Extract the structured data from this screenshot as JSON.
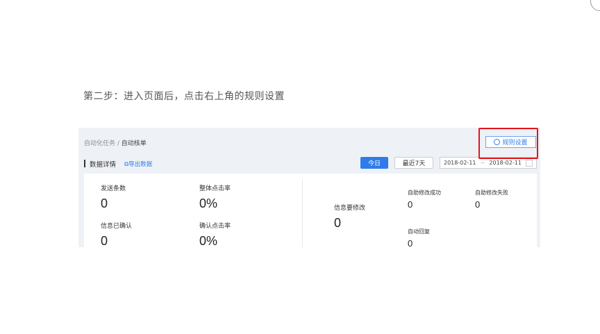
{
  "instruction": "第二步：进入页面后，点击右上角的规则设置",
  "breadcrumb": {
    "parent": "自动化任务 / ",
    "current": "自动核单"
  },
  "toolbar": {
    "rules_button": "规则设置"
  },
  "section": {
    "title": "数据详情",
    "export_link": "⧉导出数据",
    "today_button": "今日",
    "last7_button": "最近7天",
    "date_from": "2018-02-11",
    "date_sep": "~",
    "date_to": "2018-02-11"
  },
  "metrics": {
    "sent_count": {
      "label": "发送条数",
      "value": "0"
    },
    "overall_ctr": {
      "label": "整体点击率",
      "value": "0%"
    },
    "info_confirmed": {
      "label": "信息已确认",
      "value": "0"
    },
    "confirm_ctr": {
      "label": "确认点击率",
      "value": "0%"
    },
    "info_to_modify": {
      "label": "信息要修改",
      "value": "0"
    },
    "auto_modify_success": {
      "label": "自助修改成功",
      "value": "0"
    },
    "auto_modify_fail": {
      "label": "自助修改失败",
      "value": "0"
    },
    "auto_reply": {
      "label": "自动回复",
      "value": "0"
    }
  },
  "colors": {
    "accent": "#2f7ce8",
    "highlight": "#e3151b",
    "page_bg": "#eef1f6"
  }
}
